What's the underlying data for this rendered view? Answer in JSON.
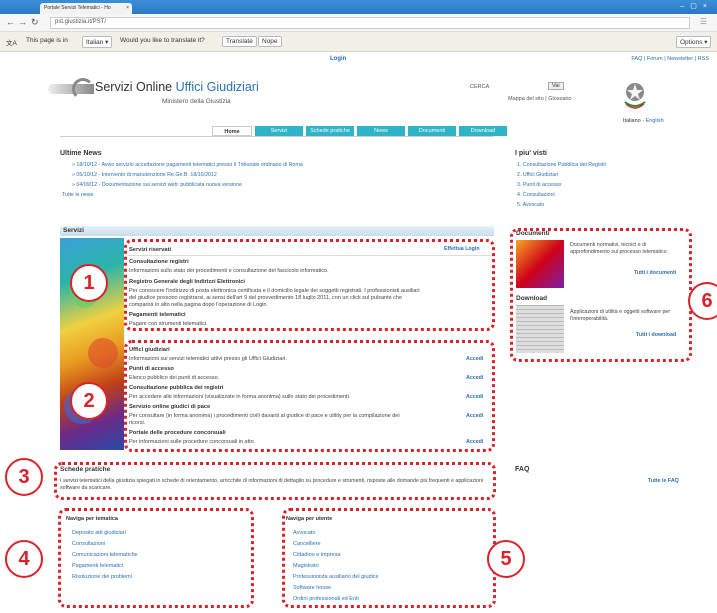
{
  "browser": {
    "tab_title": "Portale Servizi Telematici - Ho",
    "url": "pst.giustizia.it/PST/",
    "translate_prefix": "This page is in",
    "translate_lang": "Italian",
    "translate_question": "Would you like to translate it?",
    "translate_button": "Translate",
    "nope_button": "Nope",
    "options_button": "Options"
  },
  "header": {
    "login": "Login",
    "top_links": "FAQ | Forum | Newsletter | RSS",
    "logo_prefix": "Servizi Online ",
    "logo_highlight": "Uffici Giudiziari",
    "logo_sub": "Ministero della Giustizia",
    "search_label": "CERCA",
    "search_button": "Vai",
    "site_links": "Mappa del sito | Glossario",
    "lang_it": "Italiano",
    "lang_sep": " · ",
    "lang_en": "English"
  },
  "menu": [
    "Home",
    "Servizi",
    "Schede pratiche",
    "News",
    "Documenti",
    "Download"
  ],
  "news": {
    "title": "Ultime News",
    "items": [
      "» 18/10/12 - Avvio servizio accettazione pagamenti telematici presso il Tribunale ordinario di Roma",
      "» 05/10/12 - Intervento di manutenzione Re.Ge.B. 18/10/2012",
      "» 04/09/12 - Documentazione sui servizi web: pubblicata nuova versione"
    ],
    "all": "Tutte le news"
  },
  "popular": {
    "title": "I piu' visti",
    "items": [
      "1. Consultazione Pubblica dei Registri",
      "2. Uffici Giudiziari",
      "3. Punti di accesso",
      "4. Consultazioni",
      "5. Avvocato"
    ]
  },
  "servizi": {
    "title": "Servizi",
    "riservati_title": "Servizi riservati",
    "login_link": "Effettua Login",
    "consultazione_h": "Consultazione registri",
    "consultazione_d": "Informazioni sullo stato dei procedimenti e consultazione del fascicolo informatico.",
    "reginde_h": "Registro Generale degli Indirizzi Elettronici",
    "reginde_d1": "Per conoscere l'indirizzo di posta elettronica certificata e il domicilio legale dei soggetti registrati. I professionisti ausiliari",
    "reginde_d2": "del giudice possono registrarsi, ai sensi dell'art 9 del provvedimento 18 luglio 2011, con un click sul pulsante che",
    "reginde_d3": "comparirà in alto nella pagina dopo l'operazione di Login.",
    "pagamenti_h": "Pagamenti telematici",
    "pagamenti_d": "Pagare con strumenti telematici.",
    "uffici_h": "Uffici giudiziari",
    "uffici_d": "Informazioni sui servizi telematici attivi presso gli Uffici Giudiziari.",
    "punti_h": "Punti di accesso",
    "punti_d": "Elenco pubblico dei punti di accesso.",
    "pubblica_h": "Consultazione pubblica dei registri",
    "pubblica_d": "Per accedere alle informazioni (visualizzate in forma anonima) sullo stato dei procedimenti.",
    "pace_h": "Servizio online giudici di pace",
    "pace_d1": "Per consultare (in forma anonima) i procedimenti civili davanti al giudice di pace e utility per la compilazione dei",
    "pace_d2": "ricorsi.",
    "concorsuali_h": "Portale delle procedure concorsuali",
    "concorsuali_d": "Per informazioni sulle procedure concorsuali in atto.",
    "accedi": "Accedi"
  },
  "schede": {
    "title": "Schede pratiche",
    "text": "I servizi telematici della giustizia spiegati in schede di orientamento, arricchite di informazioni di dettaglio su procedure e strumenti, risposte alle domande più frequenti e applicazioni software da scaricare."
  },
  "nav_tematica": {
    "title": "Naviga per tematica",
    "items": [
      "Deposito atti giudiziari",
      "Consultazioni",
      "Comunicazioni telematiche",
      "Pagamenti telematici",
      "Risoluzione dei problemi"
    ]
  },
  "nav_utente": {
    "title": "Naviga per utente",
    "items": [
      "Avvocato",
      "Cancelliere",
      "Cittadino e impresa",
      "Magistrato",
      "Professionista ausiliario del giudice",
      "Software house",
      "Ordini professionali ed Enti"
    ]
  },
  "documenti": {
    "title": "Documenti",
    "text": "Documenti normativi, tecnici e di approfondimento sul processo telematico.",
    "link": "Tutti i documenti"
  },
  "download": {
    "title": "Download",
    "text": "Applicazioni di utilità e oggetti software per l'interoperabilità.",
    "link": "Tutti i download"
  },
  "faq": {
    "title": "FAQ",
    "link": "Tutte le FAQ"
  },
  "annotations": [
    "1",
    "2",
    "3",
    "4",
    "5",
    "6"
  ],
  "colors": {
    "accent": "#2fb3c5",
    "link": "#2b6fb6",
    "annotation": "#d8232a"
  }
}
